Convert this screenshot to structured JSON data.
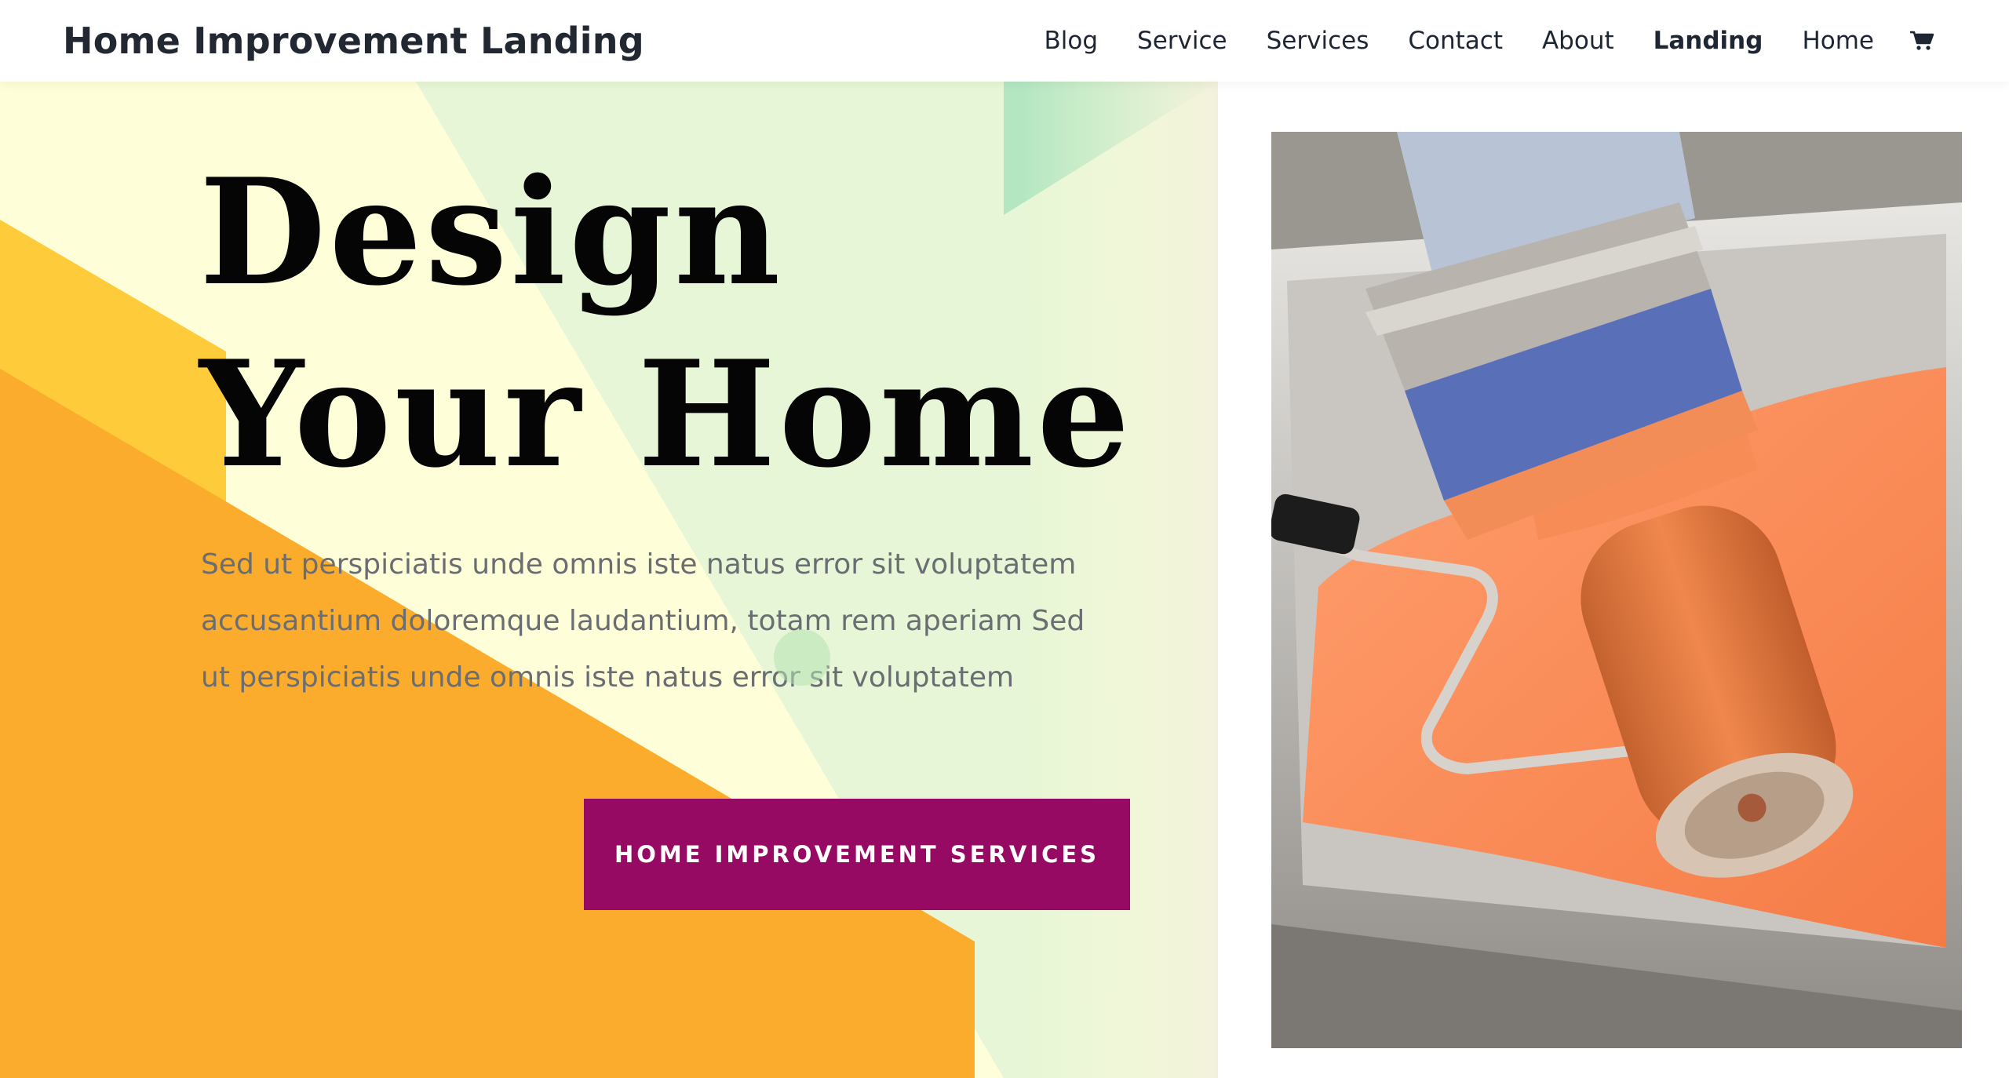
{
  "header": {
    "site_title": "Home Improvement Landing",
    "nav": [
      {
        "label": "Blog"
      },
      {
        "label": "Service"
      },
      {
        "label": "Services"
      },
      {
        "label": "Contact"
      },
      {
        "label": "About"
      },
      {
        "label": "Landing",
        "active": true
      },
      {
        "label": "Home"
      }
    ],
    "cart_icon": "cart-icon"
  },
  "hero": {
    "title_line1": "Design",
    "title_line2": "Your Home",
    "body": "Sed ut perspiciatis unde omnis iste natus error sit voluptatem accusantium doloremque laudantium, totam rem aperiam Sed ut perspiciatis unde omnis iste natus error sit voluptatem",
    "cta_label": "HOME IMPROVEMENT SERVICES"
  },
  "colors": {
    "cta_background": "#970a63",
    "orange": "#fcac2c",
    "yellow": "#fecb3a",
    "cream": "#fefed8",
    "mint": "#e6f6d6",
    "green": "#b4e6c2"
  },
  "photo": {
    "icon": "paint-roller-and-brush-photo"
  }
}
